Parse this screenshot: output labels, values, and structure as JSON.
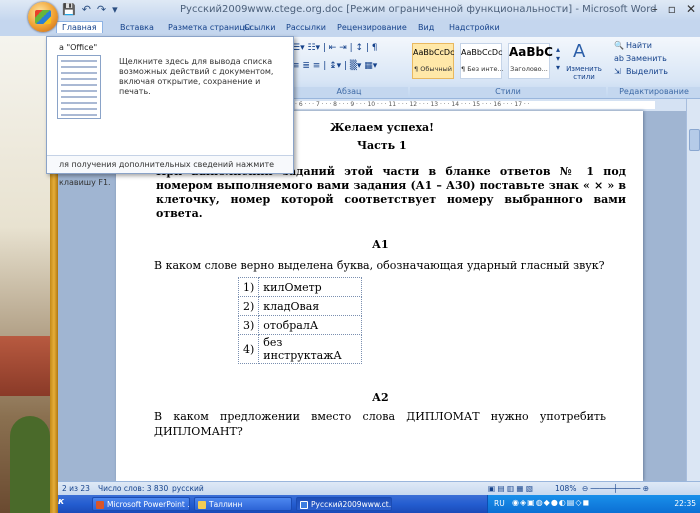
{
  "window": {
    "title": "Русский2009www.ctege.org.doc [Режим ограниченной функциональности] - Microsoft Word",
    "controls": [
      "–",
      "▫",
      "✕"
    ]
  },
  "qat": {
    "save": "💾",
    "undo": "↶",
    "redo": "↷",
    "more": "▾"
  },
  "tabs": [
    "Главная",
    "Вставка",
    "Разметка страницы",
    "Ссылки",
    "Рассылки",
    "Рецензирование",
    "Вид",
    "Надстройки"
  ],
  "ribbon": {
    "paragraph_label": "Абзац",
    "styles_label": "Стили",
    "editing_label": "Редактирование",
    "styles": [
      {
        "preview": "AaBbCcDc",
        "name": "¶ Обычный"
      },
      {
        "preview": "AaBbCcDc",
        "name": "¶ Без инте..."
      },
      {
        "preview": "AaBbC",
        "name": "Заголово..."
      }
    ],
    "change_styles": "Изменить стили",
    "find": "Найти",
    "replace": "Заменить",
    "select": "Выделить"
  },
  "office_menu": {
    "header": "а \"Office\"",
    "description": "Щелкните здесь для вывода списка возможных действий с документом, включая открытие, сохранение и печать.",
    "help": "ля получения дополнительных сведений нажмите клавишу F1."
  },
  "document": {
    "wish": "Желаем успеха!",
    "part": "Часть 1",
    "instruction": "При выполнении заданий этой части в бланке ответов № 1 под номером выполняемого вами задания (А1 – А30) поставьте знак « × »   в клеточку, номер которой соответствует номеру выбранного вами ответа.",
    "q1_label": "А1",
    "q1_text": "В каком слове верно выделена буква, обозначающая ударный гласный звук?",
    "q1_options": [
      {
        "num": "1)",
        "text": "килОметр"
      },
      {
        "num": "2)",
        "text": "кладОвая"
      },
      {
        "num": "3)",
        "text": "отобралА"
      },
      {
        "num": "4)",
        "text": "без инструктажА"
      }
    ],
    "q2_label": "А2",
    "q2_text": "В каком предложении вместо слова ДИПЛОМАТ нужно употребить ДИПЛОМАНТ?"
  },
  "statusbar": {
    "page": "2 из 23",
    "words": "Число слов: 3 830",
    "lang": "русский",
    "zoom": "108%"
  },
  "taskbar": {
    "start": "к",
    "tasks": [
      "Microsoft PowerPoint ...",
      "Таллинн",
      "Русский2009www.ct..."
    ],
    "lang": "RU",
    "clock": "22:35"
  }
}
